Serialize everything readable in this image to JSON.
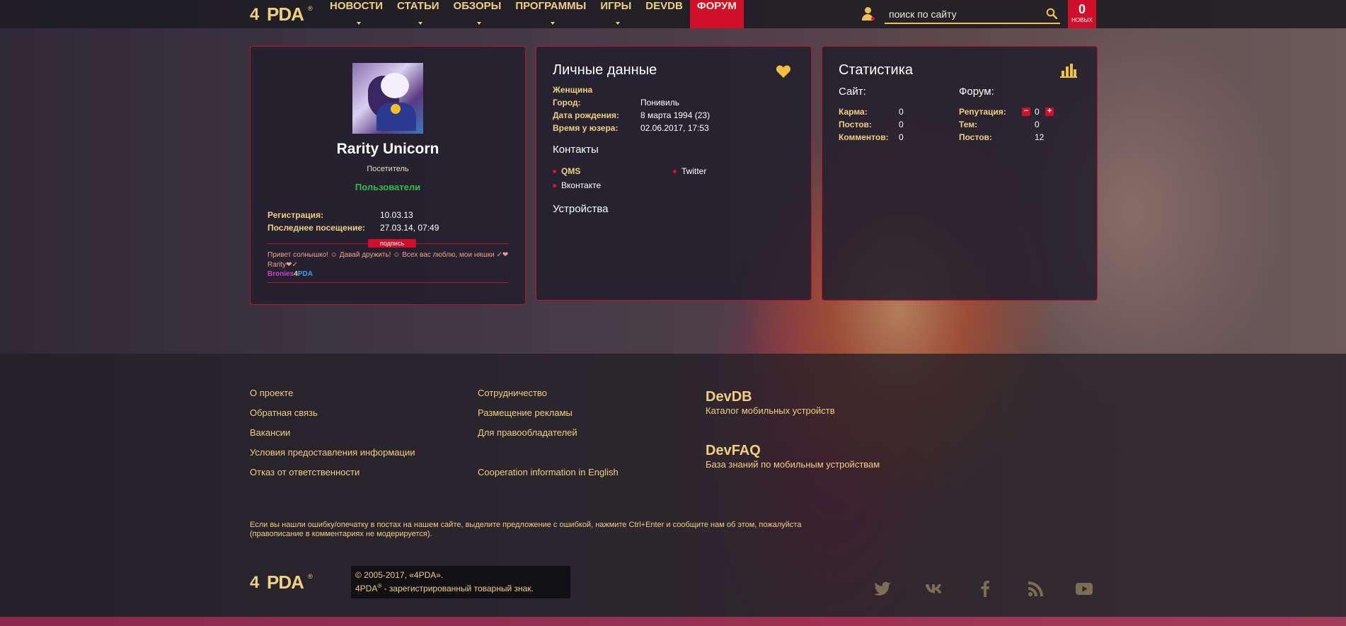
{
  "brand": {
    "four": "4",
    "pda": "PDA",
    "reg": "®"
  },
  "nav": [
    {
      "label": "НОВОСТИ",
      "dropdown": true,
      "active": false
    },
    {
      "label": "СТАТЬИ",
      "dropdown": true,
      "active": false
    },
    {
      "label": "ОБЗОРЫ",
      "dropdown": true,
      "active": false
    },
    {
      "label": "ПРОГРАММЫ",
      "dropdown": true,
      "active": false
    },
    {
      "label": "ИГРЫ",
      "dropdown": true,
      "active": false
    },
    {
      "label": "DEVDB",
      "dropdown": false,
      "active": false
    },
    {
      "label": "ФОРУМ",
      "dropdown": false,
      "active": true
    }
  ],
  "search": {
    "placeholder": "поиск по сайту"
  },
  "new_badge": {
    "count": "0",
    "label": "новых"
  },
  "profile": {
    "name": "Rarity Unicorn",
    "role": "Посетитель",
    "group": "Пользователи",
    "fields": [
      {
        "key": "Регистрация:",
        "value": "10.03.13"
      },
      {
        "key": "Последнее посещение:",
        "value": "27.03.14, 07:49"
      }
    ],
    "signature_label": "подпись",
    "signature_text": "Привет солнышко! ☺ Давай дружить! ☺ Всех вас люблю, мои няшки ✓❤",
    "signature_text2": "Rarity❤✓",
    "signature_brand": {
      "part1": "Bronies",
      "part2": "4",
      "part3": "PDA"
    }
  },
  "personal": {
    "title": "Личные данные",
    "gender": "Женщина",
    "fields": [
      {
        "key": "Город:",
        "value": "Понивиль"
      },
      {
        "key": "Дата рождения:",
        "value": "8 марта 1994 (23)"
      },
      {
        "key": "Время у юзера:",
        "value": "02.06.2017, 17:53"
      }
    ],
    "contacts_title": "Контакты",
    "contacts": [
      "QMS",
      "Twitter",
      "Вконтакте"
    ],
    "devices_title": "Устройства"
  },
  "stats": {
    "title": "Статистика",
    "site_title": "Сайт:",
    "forum_title": "Форум:",
    "site": [
      {
        "key": "Карма:",
        "value": "0"
      },
      {
        "key": "Постов:",
        "value": "0"
      },
      {
        "key": "Комментов:",
        "value": "0"
      }
    ],
    "forum": [
      {
        "key": "Репутация:",
        "value": "0"
      },
      {
        "key": "Тем:",
        "value": "0"
      },
      {
        "key": "Постов:",
        "value": "12"
      }
    ],
    "rep_minus": "−",
    "rep_plus": "+"
  },
  "footer": {
    "col1": [
      "О проекте",
      "Обратная связь",
      "Вакансии",
      "Условия предоставления информации",
      "Отказ от ответственности"
    ],
    "col2": [
      "Сотрудничество",
      "Размещение рекламы",
      "Для правообладателей",
      "Cooperation information in English"
    ],
    "devdb_title": "DevDB",
    "devdb_sub": "Каталог мобильных устройств",
    "devfaq_title": "DevFAQ",
    "devfaq_sub": "База знаний по мобильным устройствам",
    "note_line1": "Если вы нашли ошибку/опечатку в постах на нашем сайте, выделите предложение с ошибкой, нажмите Ctrl+Enter и сообщите нам об этом, пожалуйста",
    "note_line2": "(правописание в комментариях не модерируется).",
    "copyright": "© 2005-2017, «4PDA».",
    "trademark_brand": "4PDA",
    "trademark_text": " - зарегистрированный товарный знак.",
    "social": [
      "twitter-icon",
      "vk-icon",
      "facebook-icon",
      "rss-icon",
      "youtube-icon"
    ]
  },
  "colors": {
    "accent": "#d0102a",
    "gold": "#f0d080",
    "green": "#30c040"
  }
}
